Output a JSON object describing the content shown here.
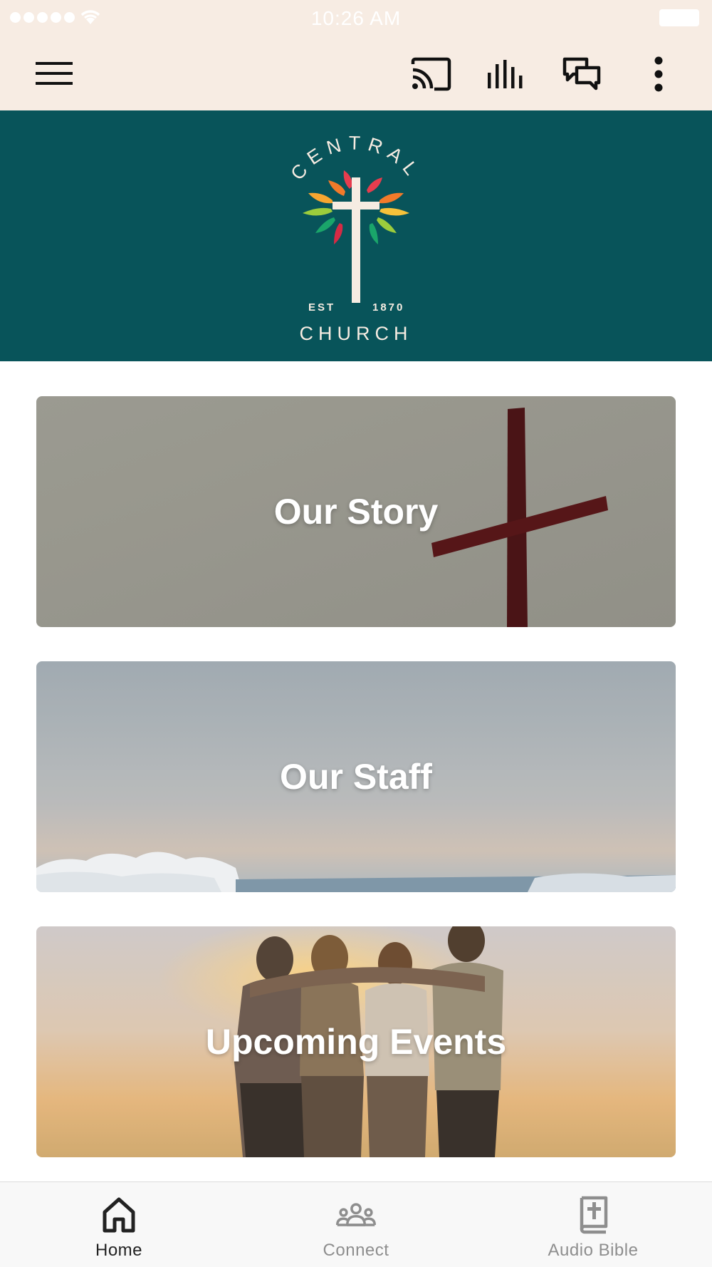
{
  "status_bar": {
    "time": "10:26 AM"
  },
  "app_bar": {
    "icons": [
      "menu-icon",
      "cast-icon",
      "audio-bars-icon",
      "chat-icon",
      "more-vertical-icon"
    ]
  },
  "hero": {
    "logo_text_top": "CENTRAL",
    "logo_est": "EST",
    "logo_year": "1870",
    "logo_text_bottom": "CHURCH",
    "background_color": "#08545a"
  },
  "cards": [
    {
      "label": "Our Story"
    },
    {
      "label": "Our Staff"
    },
    {
      "label": "Upcoming Events"
    }
  ],
  "bottom_nav": {
    "items": [
      {
        "label": "Home",
        "icon": "home-icon",
        "active": true
      },
      {
        "label": "Connect",
        "icon": "people-icon",
        "active": false
      },
      {
        "label": "Audio Bible",
        "icon": "bible-icon",
        "active": false
      }
    ]
  },
  "colors": {
    "app_bar_bg": "#f7ece3",
    "nav_active": "#222222",
    "nav_inactive": "#8e8e8e"
  }
}
